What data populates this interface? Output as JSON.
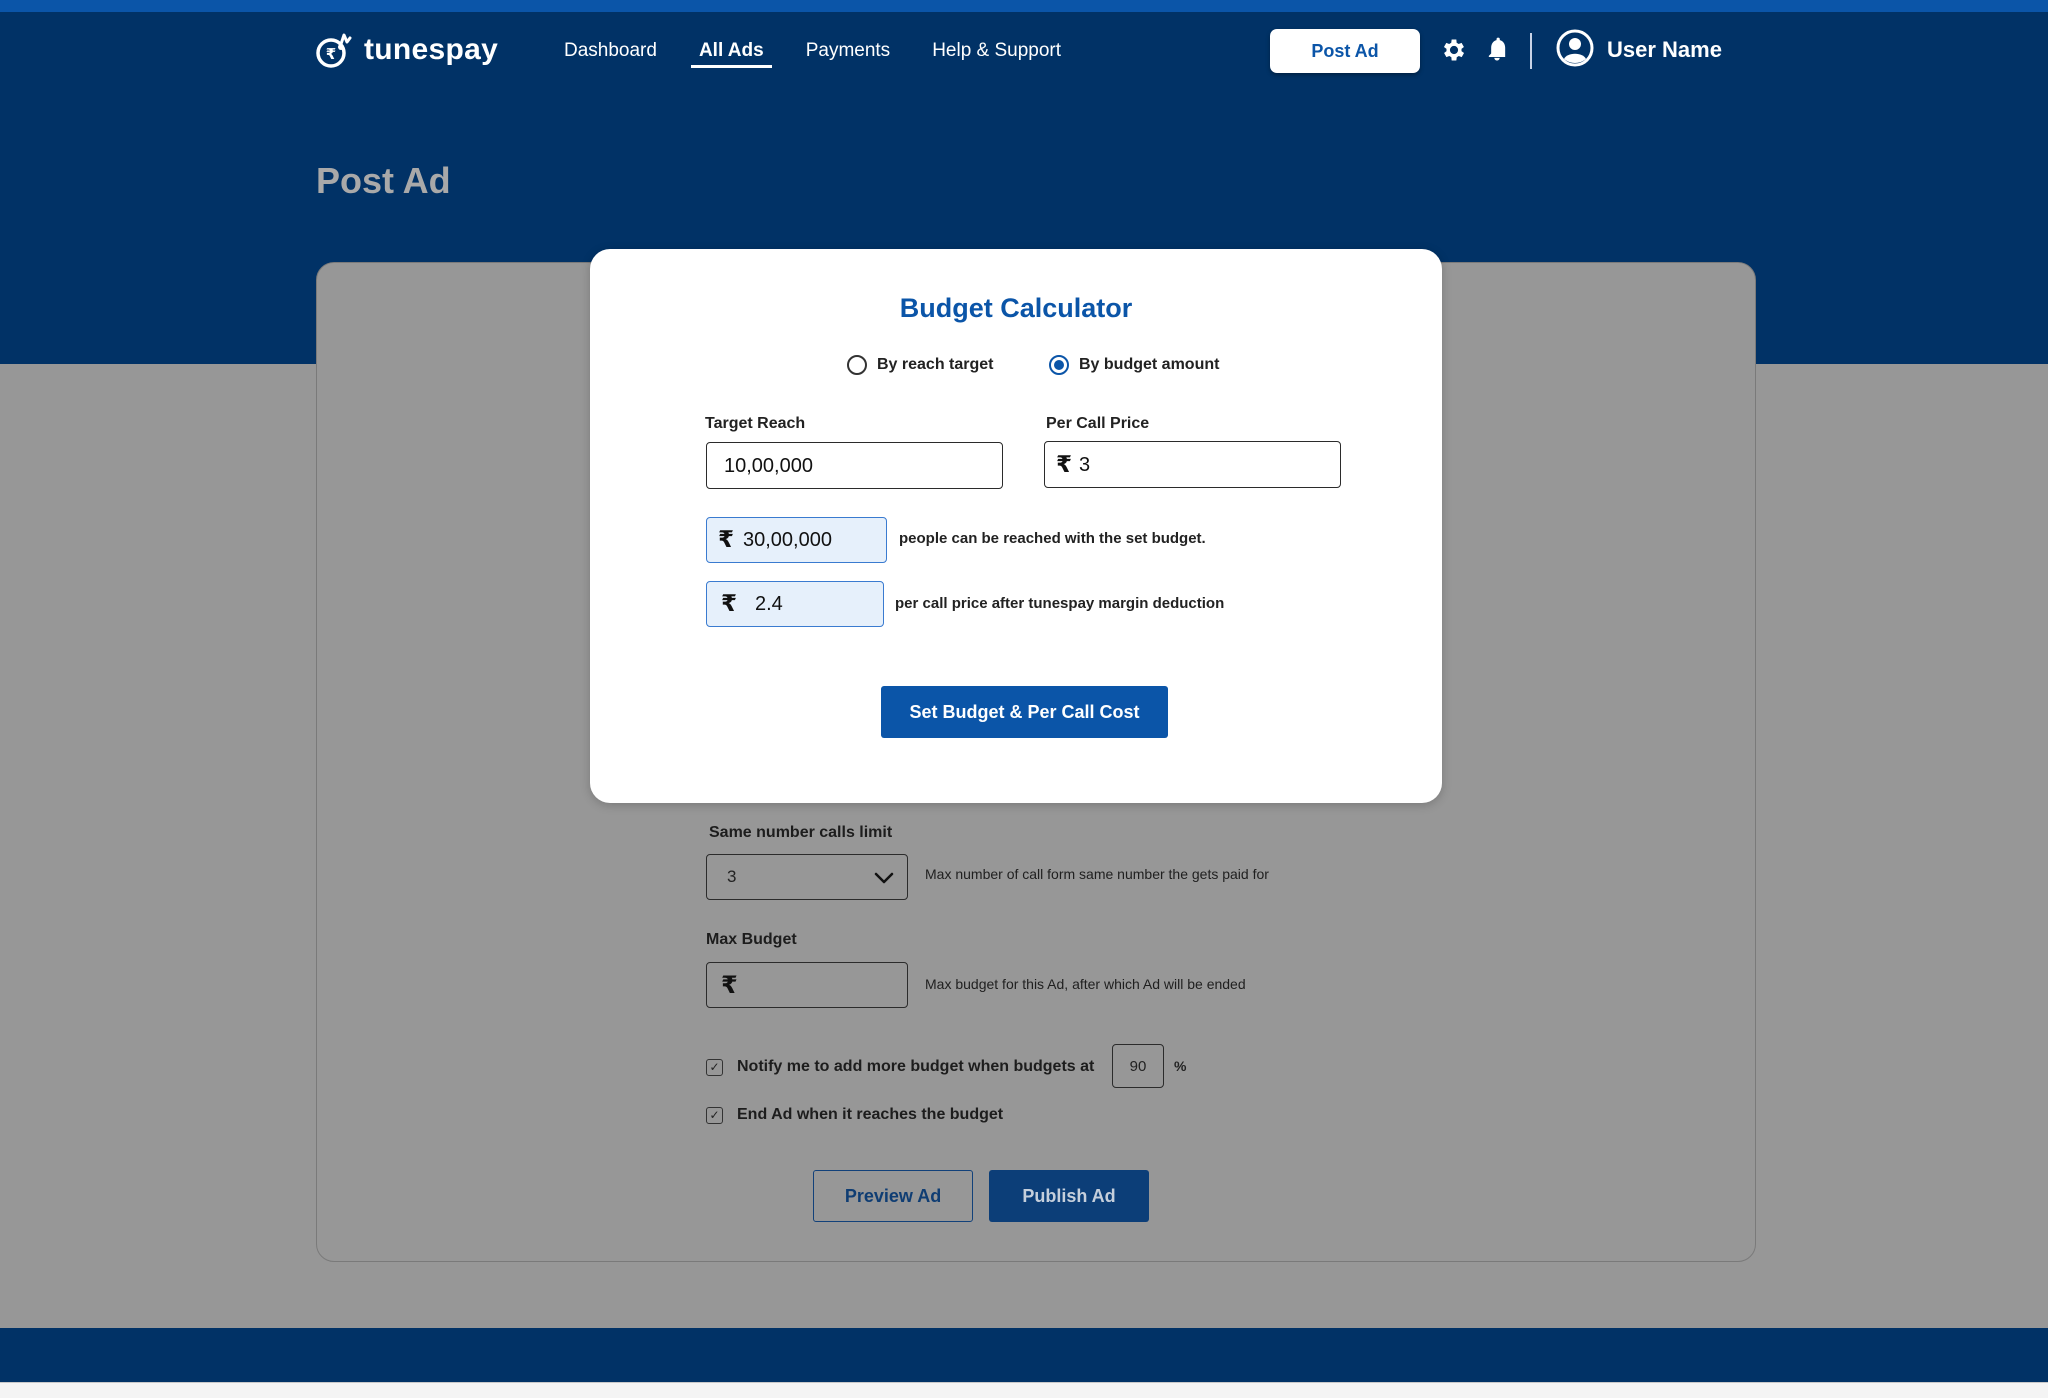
{
  "brand": {
    "name": "tunespay"
  },
  "nav": {
    "links": [
      {
        "label": "Dashboard"
      },
      {
        "label": "All Ads"
      },
      {
        "label": "Payments"
      },
      {
        "label": "Help & Support"
      }
    ],
    "active": "All Ads",
    "post_ad_label": "Post Ad",
    "user_name": "User Name"
  },
  "page": {
    "title": "Post Ad"
  },
  "form": {
    "same_number_label": "Same number calls limit",
    "same_number_value": "3",
    "same_number_help": "Max number of call form same number the gets paid for",
    "max_budget_label": "Max Budget",
    "max_budget_value": "",
    "max_budget_help": "Max budget for this Ad, after which Ad will be ended",
    "notify_label": "Notify me to add more budget when budgets at",
    "notify_percent": "90",
    "percent_sign": "%",
    "end_ad_label": "End Ad when it reaches the budget",
    "preview_label": "Preview Ad",
    "publish_label": "Publish Ad",
    "checkbox_notify": true,
    "checkbox_end": true
  },
  "modal": {
    "title": "Budget Calculator",
    "radio_reach": "By reach target",
    "radio_budget": "By budget amount",
    "selected_mode": "By budget amount",
    "target_reach_label": "Target Reach",
    "target_reach_value": "10,00,000",
    "per_call_label": "Per Call Price",
    "per_call_value": "3",
    "budget_result": "30,00,000",
    "budget_result_text": "people can be reached with the set budget.",
    "net_price_result": "2.4",
    "net_price_text": "per call price after tunespay margin deduction",
    "set_button_label": "Set Budget & Per Call Cost",
    "currency_symbol": "₹"
  },
  "colors": {
    "primary": "#0b55a8",
    "navy": "#013266",
    "overlay_gray": "#979797",
    "calc_fill": "#e6f0fb"
  },
  "icons": [
    "settings-gear-icon",
    "notification-bell-icon",
    "user-avatar-icon",
    "chevron-down-icon",
    "rupee-icon",
    "checkmark-icon"
  ]
}
